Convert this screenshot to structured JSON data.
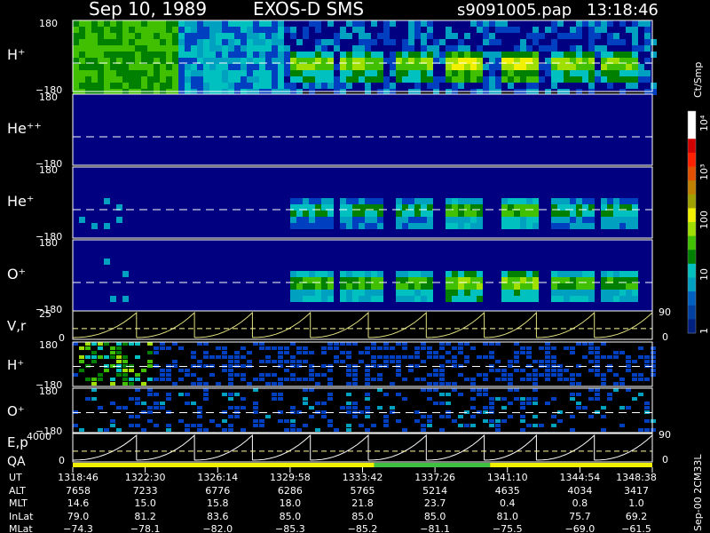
{
  "header": {
    "date": "Sep 10, 1989",
    "instrument": "EXOS-D SMS",
    "file": "s9091005.pap",
    "time": "13:18:46"
  },
  "side_label": "Sep-00 2CM33L",
  "colorbar": {
    "title": "Ct/Smp",
    "labels": [
      "10⁴",
      "10³",
      "100",
      "10",
      "1"
    ],
    "colors": [
      "#ffffff",
      "#ffffff",
      "#d00000",
      "#ff2000",
      "#e05000",
      "#c08000",
      "#a0a000",
      "#f0f000",
      "#a0e000",
      "#40c000",
      "#008000",
      "#00c0c0",
      "#00a0c0",
      "#0060c0",
      "#0040a0",
      "#002080"
    ]
  },
  "chart_data": {
    "type": "heatmap",
    "title": "Sep 10, 1989   EXOS-D SMS",
    "panels": [
      {
        "id": "h-plus",
        "label": "H⁺",
        "ytop": "180",
        "ybot": "−180",
        "yrange": [
          -180,
          180
        ],
        "peak": 4,
        "bg": 1,
        "speckle": true
      },
      {
        "id": "he-plus-plus",
        "label": "He⁺⁺",
        "ytop": "180",
        "ybot": "−180",
        "yrange": [
          -180,
          180
        ],
        "peak": 0,
        "bg": 0,
        "speckle": false
      },
      {
        "id": "he-plus",
        "label": "He⁺",
        "ytop": "180",
        "ybot": "−180",
        "yrange": [
          -180,
          180
        ],
        "peak": 2,
        "bg": 0,
        "speckle": false
      },
      {
        "id": "o-plus",
        "label": "O⁺",
        "ytop": "180",
        "ybot": "−180",
        "yrange": [
          -180,
          180
        ],
        "peak": 3,
        "bg": 0,
        "speckle": false
      }
    ],
    "line_panels": [
      {
        "id": "v-r",
        "label": "V,r",
        "ytop": "25",
        "ybot": "0",
        "right_top": "90",
        "right_bot": "0"
      },
      {
        "id": "h-plus-2",
        "label": "H⁺",
        "ytop": "180",
        "ybot": "−180"
      },
      {
        "id": "o-plus-2",
        "label": "O⁺",
        "ytop": "180",
        "ybot": "−180"
      },
      {
        "id": "e-p",
        "label": "E,p",
        "label2": "QA",
        "ytop": "4000",
        "ybot": "0",
        "right_top": "90",
        "right_bot": "0"
      }
    ],
    "time_axis": {
      "row_labels": [
        "UT",
        "ALT",
        "MLT",
        "InLat",
        "MLat"
      ],
      "columns": [
        {
          "UT": "1318:46",
          "ALT": "7658",
          "MLT": "14.6",
          "InLat": "79.0",
          "MLat": "−74.3"
        },
        {
          "UT": "1322:30",
          "ALT": "7233",
          "MLT": "15.0",
          "InLat": "81.2",
          "MLat": "−78.1"
        },
        {
          "UT": "1326:14",
          "ALT": "6776",
          "MLT": "15.8",
          "InLat": "83.6",
          "MLat": "−82.0"
        },
        {
          "UT": "1329:58",
          "ALT": "6286",
          "MLT": "18.0",
          "InLat": "85.0",
          "MLat": "−85.3"
        },
        {
          "UT": "1333:42",
          "ALT": "5765",
          "MLT": "21.8",
          "InLat": "85.0",
          "MLat": "−85.2"
        },
        {
          "UT": "1337:26",
          "ALT": "5214",
          "MLT": "23.7",
          "InLat": "85.0",
          "MLat": "−81.1"
        },
        {
          "UT": "1341:10",
          "ALT": "4635",
          "MLT": "0.4",
          "InLat": "81.0",
          "MLat": "−75.5"
        },
        {
          "UT": "1344:54",
          "ALT": "4034",
          "MLT": "0.8",
          "InLat": "75.7",
          "MLat": "−69.0"
        },
        {
          "UT": "1348:38",
          "ALT": "3417",
          "MLT": "1.0",
          "InLat": "69.2",
          "MLat": "−61.5"
        }
      ]
    },
    "qa_bar": [
      {
        "from": 0.0,
        "to": 0.52,
        "color": "#f0f000"
      },
      {
        "from": 0.52,
        "to": 0.72,
        "color": "#40c040"
      },
      {
        "from": 0.72,
        "to": 1.0,
        "color": "#f0f000"
      }
    ]
  }
}
